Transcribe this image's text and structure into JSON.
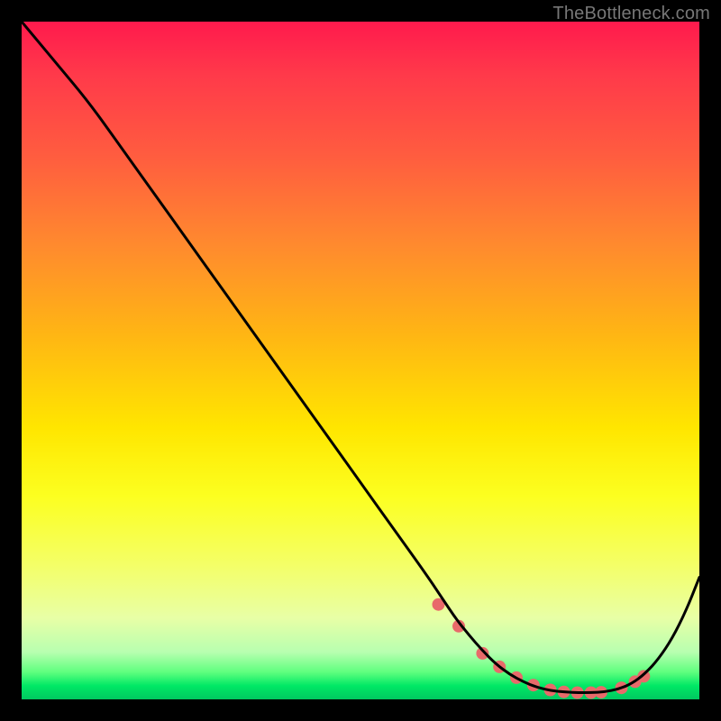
{
  "watermark": "TheBottleneck.com",
  "chart_data": {
    "type": "line",
    "title": "",
    "xlabel": "",
    "ylabel": "",
    "xlim": [
      0,
      100
    ],
    "ylim": [
      0,
      100
    ],
    "grid": false,
    "series": [
      {
        "name": "curve",
        "x": [
          0,
          5,
          10,
          15,
          20,
          25,
          30,
          35,
          40,
          45,
          50,
          55,
          60,
          62,
          64,
          66,
          68,
          70,
          72,
          74,
          76,
          78,
          80,
          82,
          84,
          86,
          88,
          90,
          92,
          94,
          96,
          98,
          100
        ],
        "y": [
          100,
          94,
          88,
          81,
          74,
          67,
          60,
          53,
          46,
          39,
          32,
          25,
          18,
          15,
          12,
          9.5,
          7.2,
          5.2,
          3.7,
          2.6,
          1.8,
          1.3,
          1.1,
          1.0,
          1.0,
          1.1,
          1.5,
          2.3,
          3.8,
          6.0,
          9.0,
          13.0,
          18.0
        ]
      }
    ],
    "markers": {
      "name": "dots",
      "x": [
        61.5,
        64.5,
        68,
        70.5,
        73,
        75.5,
        78,
        80,
        82,
        84,
        85.5,
        88.5,
        90.5,
        91.8
      ],
      "y": [
        14.0,
        10.8,
        6.8,
        4.8,
        3.2,
        2.1,
        1.4,
        1.1,
        1.0,
        1.0,
        1.05,
        1.7,
        2.6,
        3.4
      ],
      "color": "#e86a6a",
      "radius": 7
    },
    "line_color": "#000000",
    "line_width": 3
  }
}
